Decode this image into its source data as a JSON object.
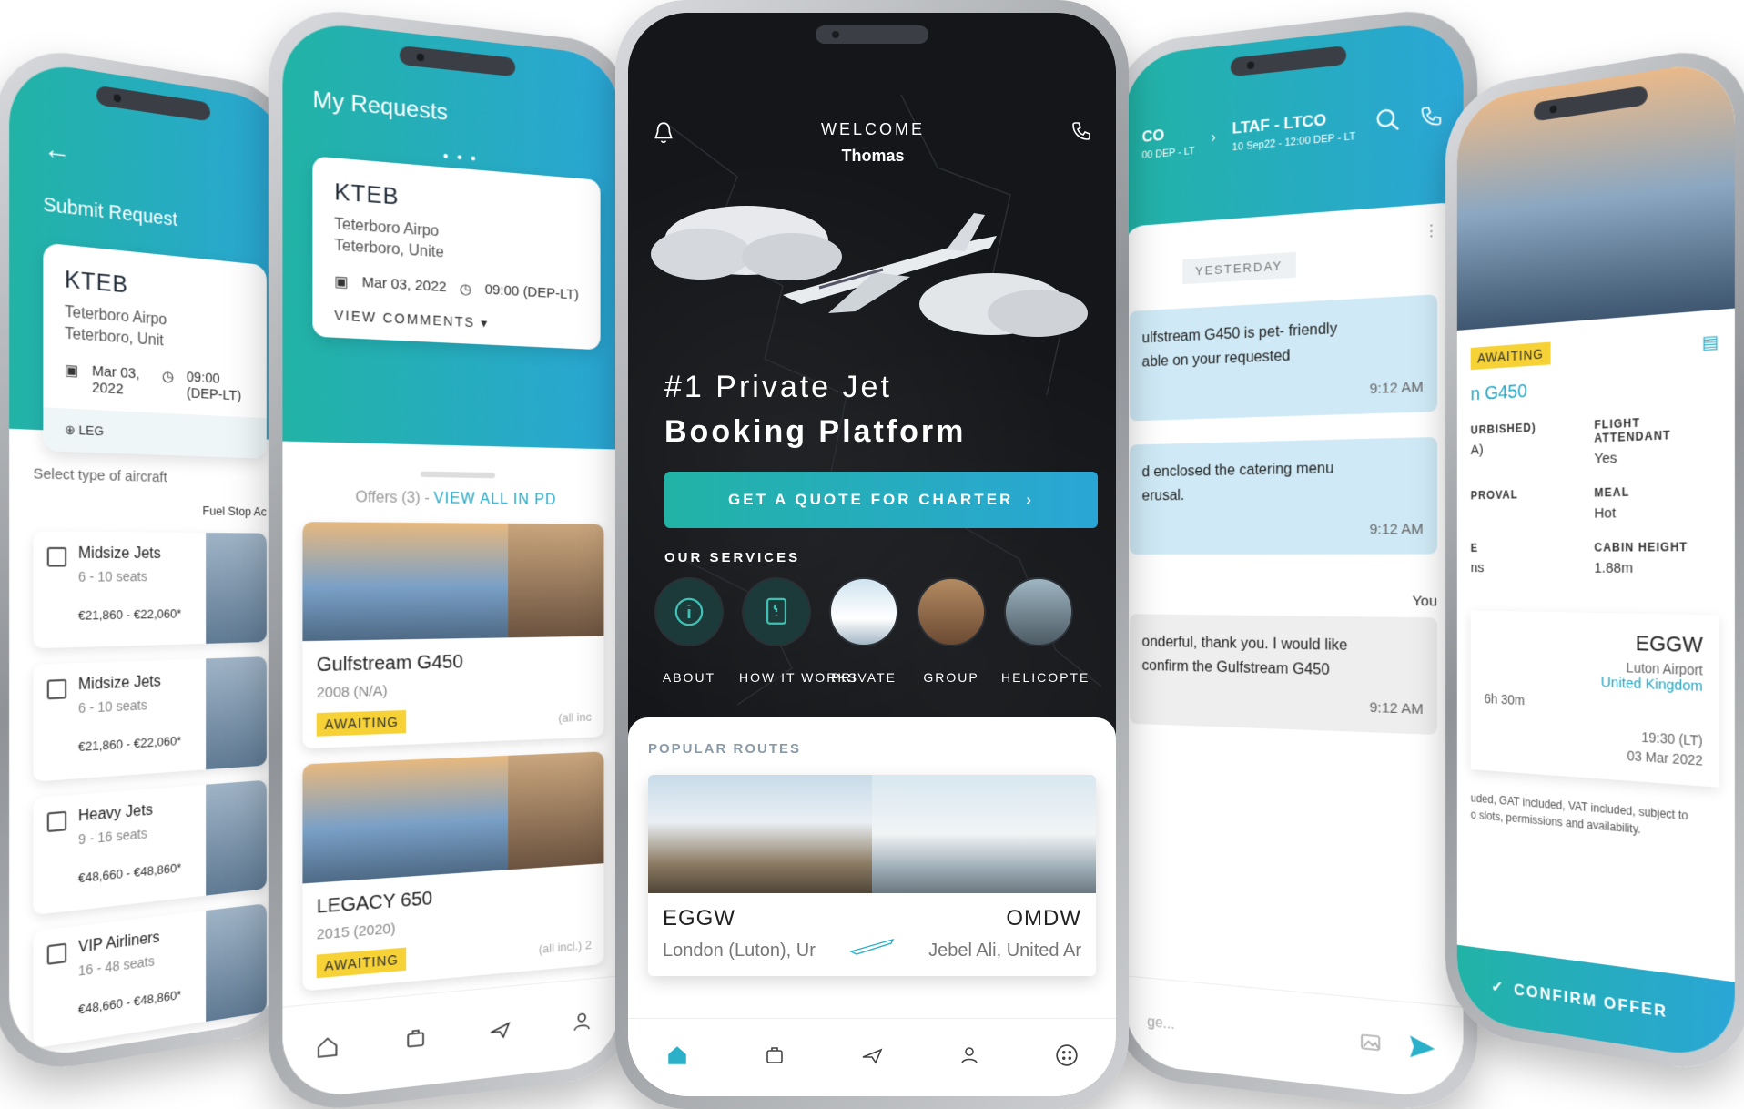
{
  "colors": {
    "teal_start": "#22b3a6",
    "teal_end": "#2aa6d6",
    "awaiting_badge": "#f6d236",
    "dark_bg": "#141619",
    "chat_bubble": "#cfeaf6"
  },
  "submit_request": {
    "title": "Submit Request",
    "card": {
      "code": "KTEB",
      "airport_line1": "Teterboro Airpo",
      "airport_line2": "Teterboro, Unit",
      "date": "Mar 03, 2022",
      "time": "09:00 (DEP-LT)",
      "leg_label": "LEG"
    },
    "select_label": "Select type of aircraft",
    "fuel_label": "Fuel Stop Ac",
    "aircraft": [
      {
        "name": "Midsize Jets",
        "seats": "6 - 10 seats",
        "price": "€21,860 - €22,060*"
      },
      {
        "name": "Midsize Jets",
        "seats": "6 - 10 seats",
        "price": "€21,860 - €22,060*"
      },
      {
        "name": "Heavy Jets",
        "seats": "9 - 16 seats",
        "price": "€48,660 - €48,860*"
      },
      {
        "name": "VIP Airliners",
        "seats": "16 - 48 seats",
        "price": "€48,660 - €48,860*"
      }
    ]
  },
  "my_requests": {
    "title": "My Requests",
    "card": {
      "code": "KTEB",
      "airport_line1": "Teterboro Airpo",
      "airport_line2": "Teterboro, Unite",
      "date": "Mar 03, 2022",
      "time": "09:00 (DEP-LT)",
      "view_comments": "VIEW COMMENTS"
    },
    "offers_count": "Offers (3) -",
    "view_all": "VIEW ALL IN PD",
    "offers": [
      {
        "name": "Gulfstream G450",
        "year": "2008 (N/A)",
        "status": "AWAITING",
        "incl": "(all inc"
      },
      {
        "name": "LEGACY 650",
        "year": "2015 (2020)",
        "status": "AWAITING",
        "incl": "(all incl.) 2"
      }
    ]
  },
  "home": {
    "welcome": "WELCOME",
    "user_name": "Thomas",
    "headline_line1": "#1 Private Jet",
    "headline_line2": "Booking Platform",
    "cta_label": "GET A QUOTE FOR CHARTER",
    "services_title": "OUR SERVICES",
    "services": [
      {
        "label": "ABOUT",
        "icon": "info-icon"
      },
      {
        "label": "HOW IT WORKS",
        "icon": "book-icon"
      },
      {
        "label": "PRIVATE",
        "icon": "private-jet-photo"
      },
      {
        "label": "GROUP",
        "icon": "cabin-photo"
      },
      {
        "label": "HELICOPTE",
        "icon": "helicopter-photo"
      }
    ],
    "popular_title": "POPULAR ROUTES",
    "route": {
      "from_code": "EGGW",
      "from_name": "London (Luton), Ur",
      "to_code": "OMDW",
      "to_name": "Jebel Ali, United Ar"
    }
  },
  "chat": {
    "route_prev_code": "CO",
    "route_prev_sub": "00 DEP - LT",
    "route_code": "LTAF - LTCO",
    "route_sub": "10 Sep22 - 12:00 DEP - LT",
    "day_label": "YESTERDAY",
    "messages": [
      {
        "line1": "ulfstream G450 is pet- friendly",
        "line2": "able on your requested",
        "time": "9:12 AM"
      },
      {
        "line1": "d enclosed the catering menu",
        "line2": "erusal.",
        "time": "9:12 AM"
      }
    ],
    "you_label": "You",
    "my_message": {
      "line1": "onderful, thank you. I would like",
      "line2": "confirm the Gulfstream G450",
      "time": "9:12 AM"
    },
    "input_placeholder": "ge..."
  },
  "offer_detail": {
    "status": "AWAITING",
    "jet_name": "n G450",
    "specs": [
      {
        "key": "URBISHED)",
        "value": "A)"
      },
      {
        "key": "FLIGHT ATTENDANT",
        "value": "Yes"
      },
      {
        "key": "PROVAL",
        "value": ""
      },
      {
        "key": "MEAL",
        "value": "Hot"
      },
      {
        "key": "E",
        "value": "ns"
      },
      {
        "key": "CABIN HEIGHT",
        "value": "1.88m"
      }
    ],
    "arrival": {
      "code": "EGGW",
      "name": "Luton Airport",
      "country": "United Kingdom",
      "time": "19:30 (LT)",
      "date": "03 Mar 2022",
      "duration": "6h 30m"
    },
    "fine_print_1": "uded, GAT included, VAT included, subject to",
    "fine_print_2": "o slots, permissions and availability.",
    "confirm_label": "CONFIRM OFFER"
  }
}
